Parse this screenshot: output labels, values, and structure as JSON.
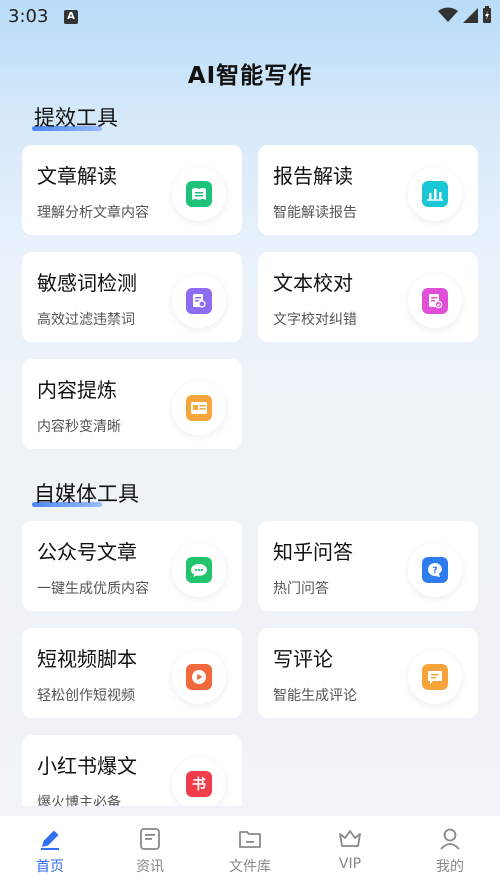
{
  "status": {
    "time": "3:03",
    "notif_icon": "A"
  },
  "app_title": "AI智能写作",
  "sections": [
    {
      "title": "提效工具",
      "cards": [
        {
          "title": "文章解读",
          "subtitle": "理解分析文章内容",
          "icon": "book-icon",
          "color": "#1fc27a"
        },
        {
          "title": "报告解读",
          "subtitle": "智能解读报告",
          "icon": "chart-icon",
          "color": "#18c6d6"
        },
        {
          "title": "敏感词检测",
          "subtitle": "高效过滤违禁词",
          "icon": "doc-search-icon",
          "color": "#8d6cf2"
        },
        {
          "title": "文本校对",
          "subtitle": "文字校对纠错",
          "icon": "doc-check-icon",
          "color": "#e04fd6"
        },
        {
          "title": "内容提炼",
          "subtitle": "内容秒变清晰",
          "icon": "id-card-icon",
          "color": "#f6a53b"
        }
      ]
    },
    {
      "title": "自媒体工具",
      "cards": [
        {
          "title": "公众号文章",
          "subtitle": "一键生成优质内容",
          "icon": "chat-bubble-icon",
          "color": "#22c46e"
        },
        {
          "title": "知乎问答",
          "subtitle": "热门问答",
          "icon": "question-icon",
          "color": "#2f7cf0"
        },
        {
          "title": "短视频脚本",
          "subtitle": "轻松创作短视频",
          "icon": "play-icon",
          "color": "#f1683c"
        },
        {
          "title": "写评论",
          "subtitle": "智能生成评论",
          "icon": "comment-icon",
          "color": "#f7a43a"
        },
        {
          "title": "小红书爆文",
          "subtitle": "爆火博主必备",
          "icon": "shu-icon",
          "icon_text": "书",
          "color": "#ef3d4b"
        }
      ]
    }
  ],
  "nav": [
    {
      "label": "首页",
      "icon": "pen-icon",
      "active": true
    },
    {
      "label": "资讯",
      "icon": "news-icon"
    },
    {
      "label": "文件库",
      "icon": "folder-icon"
    },
    {
      "label": "VIP",
      "icon": "crown-icon"
    },
    {
      "label": "我的",
      "icon": "user-icon"
    }
  ],
  "accent": "#2f6ff0"
}
